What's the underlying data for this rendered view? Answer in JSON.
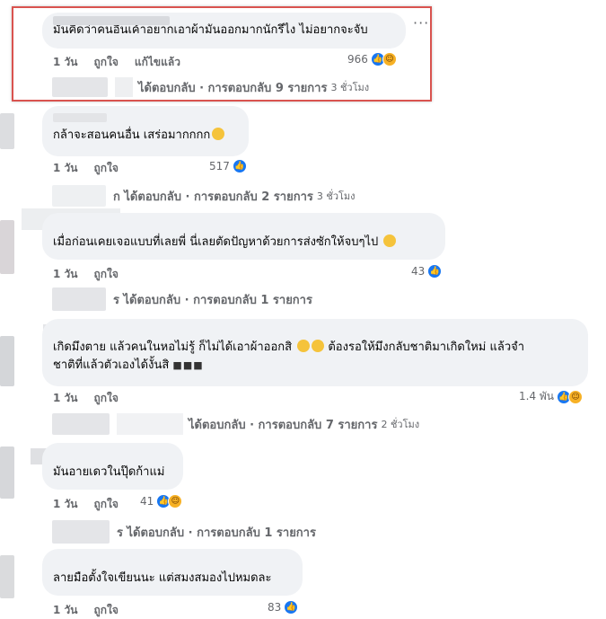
{
  "comments": [
    {
      "text": "มันคิดว่าคนอื่นเค้าอยากเอาผ้ามันออกมากนักรึไง ไม่อยากจะจับ",
      "age": "1 วัน",
      "like": "ถูกใจ",
      "edited": "แก้ไขแล้ว",
      "reactions": "966",
      "reply_text": "ได้ตอบกลับ · การตอบกลับ 9 รายการ",
      "reply_time": "3 ชั่วโมง"
    },
    {
      "text": "กล้าจะสอนคนอื่น เสร่อมากกกก",
      "age": "1 วัน",
      "like": "ถูกใจ",
      "reactions": "517",
      "reply_text": "ก ได้ตอบกลับ · การตอบกลับ 2 รายการ",
      "reply_time": "3 ชั่วโมง"
    },
    {
      "text": "เมื่อก่อนเคยเจอแบบที่เลยพี่ นี่เลยตัดปัญหาด้วยการส่งซักให้จบๆไป",
      "age": "1 วัน",
      "like": "ถูกใจ",
      "reactions": "43",
      "reply_text": "ร ได้ตอบกลับ · การตอบกลับ 1 รายการ"
    },
    {
      "text_line1": "เกิดมึงตาย แล้วคนในหอไม่รู้ ก็ไม่ได้เอาผ้าออกสิ",
      "text_line1b": "ต้องรอให้มึงกลับชาติมาเกิดใหม่ แล้วจำ",
      "text_line2": "ชาติที่แล้วตัวเองได้งั้นสิ",
      "age": "1 วัน",
      "like": "ถูกใจ",
      "reactions": "1.4 พัน",
      "reply_text": "ได้ตอบกลับ · การตอบกลับ 7 รายการ",
      "reply_time": "2 ชั่วโมง"
    },
    {
      "text": "มันอายเดวในปุ๊ดก้าแม่",
      "age": "1 วัน",
      "like": "ถูกใจ",
      "reactions": "41",
      "reply_text": "ร ได้ตอบกลับ · การตอบกลับ 1 รายการ"
    },
    {
      "text": "ลายมือตั้งใจเขียนนะ แต่สมงสมองไปหมดละ",
      "age": "1 วัน",
      "like": "ถูกใจ",
      "reactions": "83"
    }
  ],
  "icons": {
    "like": "like-icon",
    "haha": "haha-icon",
    "more": "more-options-icon"
  },
  "colors": {
    "highlight": "#d9534f",
    "like_blue": "#1877f2",
    "bubble": "#f0f2f5"
  }
}
